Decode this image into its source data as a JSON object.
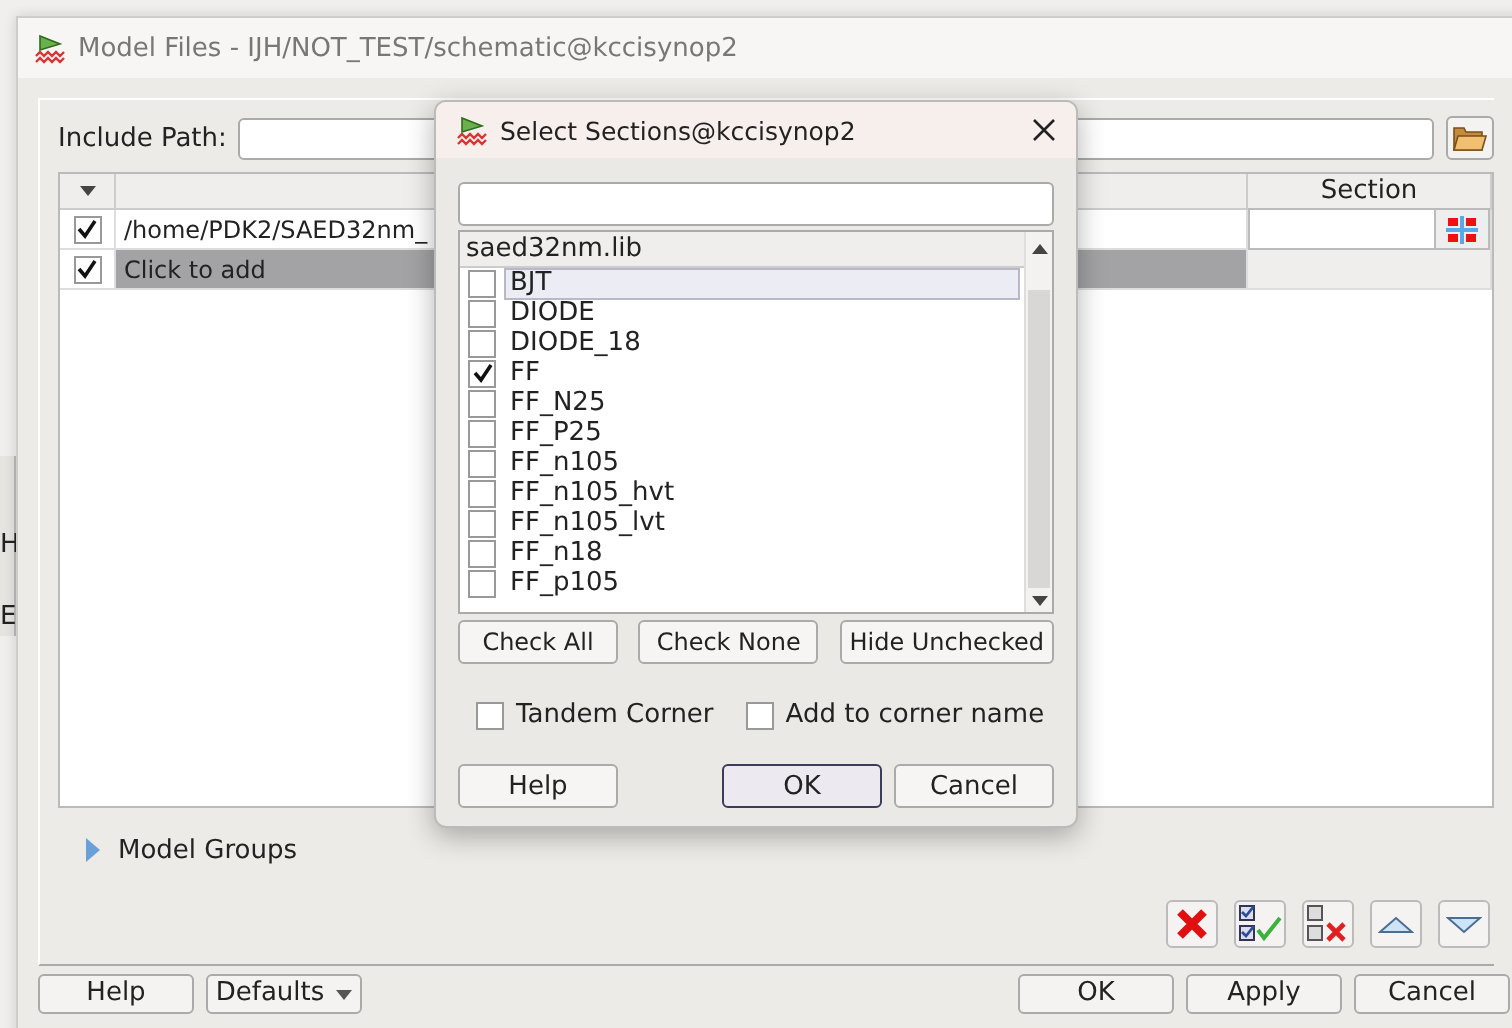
{
  "background_window": {
    "labels": [
      "H",
      "E"
    ]
  },
  "main_window": {
    "title": "Model Files - IJH/NOT_TEST/schematic@kccisynop2",
    "include_path": {
      "label": "Include Path:"
    },
    "table": {
      "section_heading": "Section",
      "rows": [
        {
          "checked": true,
          "path": "/home/PDK2/SAED32nm_",
          "selected": false
        },
        {
          "checked": true,
          "path": "Click to add",
          "selected": true
        }
      ]
    },
    "model_groups": {
      "label": "Model Groups",
      "expanded": false
    },
    "buttons": [
      {
        "label": "Help",
        "kind": "button"
      },
      {
        "label": "Defaults",
        "kind": "dropdown"
      },
      {
        "label": "OK",
        "kind": "button"
      },
      {
        "label": "Apply",
        "kind": "button"
      },
      {
        "label": "Cancel",
        "kind": "button"
      }
    ]
  },
  "dialog": {
    "title": "Select Sections@kccisynop2",
    "list_heading": "saed32nm.lib",
    "items": [
      {
        "label": "BJT",
        "checked": false,
        "selected": true
      },
      {
        "label": "DIODE",
        "checked": false,
        "selected": false
      },
      {
        "label": "DIODE_18",
        "checked": false,
        "selected": false
      },
      {
        "label": "FF",
        "checked": true,
        "selected": false
      },
      {
        "label": "FF_N25",
        "checked": false,
        "selected": false
      },
      {
        "label": "FF_P25",
        "checked": false,
        "selected": false
      },
      {
        "label": "FF_n105",
        "checked": false,
        "selected": false
      },
      {
        "label": "FF_n105_hvt",
        "checked": false,
        "selected": false
      },
      {
        "label": "FF_n105_lvt",
        "checked": false,
        "selected": false
      },
      {
        "label": "FF_n18",
        "checked": false,
        "selected": false
      },
      {
        "label": "FF_p105",
        "checked": false,
        "selected": false
      }
    ],
    "list_buttons": [
      "Check All",
      "Check None",
      "Hide Unchecked"
    ],
    "options": [
      {
        "label": "Tandem Corner",
        "checked": false
      },
      {
        "label": "Add to corner name",
        "checked": false
      }
    ],
    "buttons": [
      {
        "label": "Help",
        "default": false
      },
      {
        "label": "OK",
        "default": true
      },
      {
        "label": "Cancel",
        "default": false
      }
    ]
  }
}
